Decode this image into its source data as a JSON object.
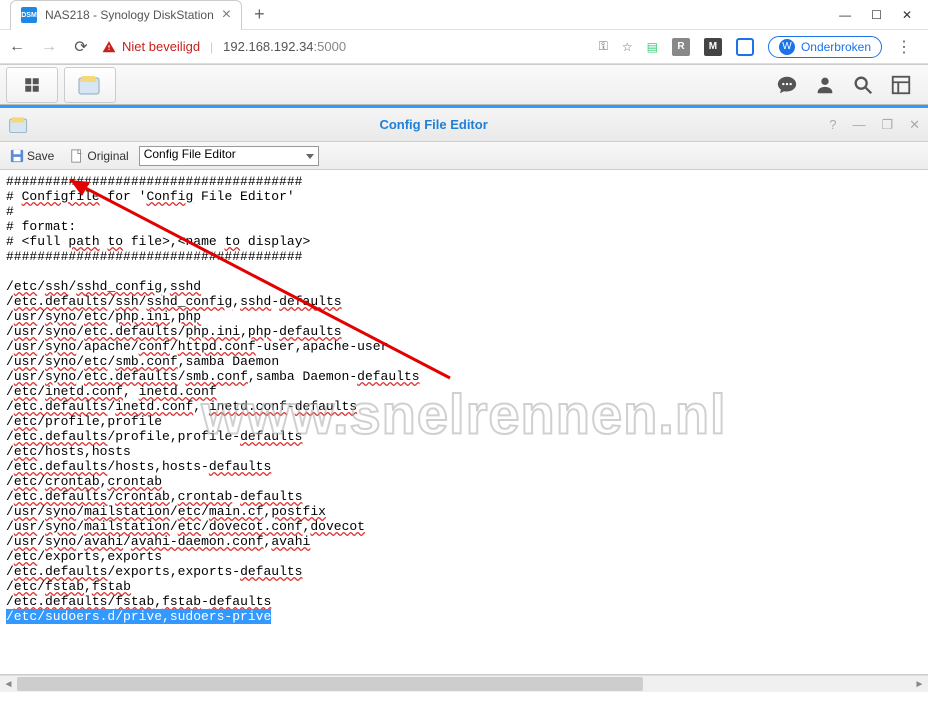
{
  "browser": {
    "tab_title": "NAS218 - Synology DiskStation",
    "favicon_text": "DSM",
    "security_label": "Niet beveiligd",
    "url_host": "192.168.192.34",
    "url_port": ":5000",
    "profile_initial": "W",
    "profile_label": "Onderbroken",
    "ext1": "R",
    "ext2": "M"
  },
  "window": {
    "title": "Config File Editor"
  },
  "toolbar": {
    "save": "Save",
    "original": "Original",
    "dropdown": "Config File Editor"
  },
  "watermark": "www.snelrennen.nl",
  "file": {
    "header1": "######################################",
    "h2": "# Configfile for 'Config File Editor'",
    "h3": "#",
    "h4": "# format:",
    "h5": "# <full path to file>,<name to display>",
    "header2": "######################################",
    "lines": [
      "/etc/ssh/sshd_config,sshd",
      "/etc.defaults/ssh/sshd_config,sshd-defaults",
      "/usr/syno/etc/php.ini,php",
      "/usr/syno/etc.defaults/php.ini,php-defaults",
      "/usr/syno/apache/conf/httpd.conf-user,apache-user",
      "/usr/syno/etc/smb.conf,samba Daemon",
      "/usr/syno/etc.defaults/smb.conf,samba Daemon-defaults",
      "/etc/inetd.conf, inetd.conf",
      "/etc.defaults/inetd.conf, inetd.conf-defaults",
      "/etc/profile,profile",
      "/etc.defaults/profile,profile-defaults",
      "/etc/hosts,hosts",
      "/etc.defaults/hosts,hosts-defaults",
      "/etc/crontab,crontab",
      "/etc.defaults/crontab,crontab-defaults",
      "/usr/syno/mailstation/etc/main.cf,postfix",
      "/usr/syno/mailstation/etc/dovecot.conf,dovecot",
      "/usr/syno/avahi/avahi-daemon.conf,avahi",
      "/etc/exports,exports",
      "/etc.defaults/exports,exports-defaults",
      "/etc/fstab,fstab",
      "/etc.defaults/fstab,fstab-defaults"
    ],
    "selected": "/etc/sudoers.d/prive,sudoers-prive"
  }
}
